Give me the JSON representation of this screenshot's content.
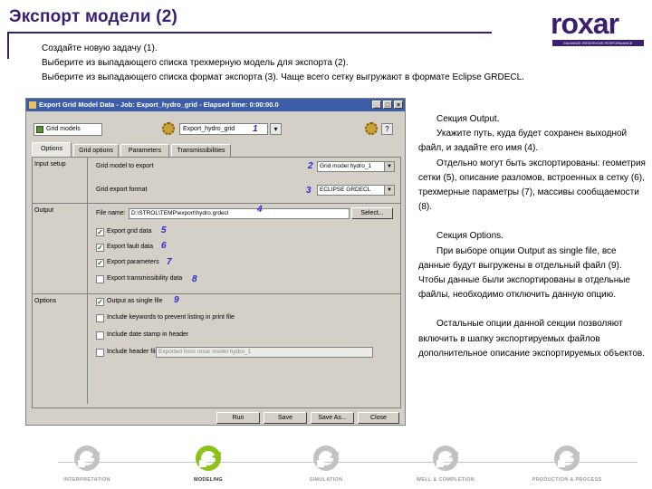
{
  "header": {
    "title": "Экспорт модели (2)",
    "logo_text": "roxar",
    "logo_strap": "MAXIMIZE RESERVOIR PERFORMANCE"
  },
  "intro_lines": [
    "Создайте новую задачу (1).",
    "Выберите из выпадающего списка трехмерную модель для экспорта (2).",
    "Выберите из выпадающего списка формат экспорта (3). Чаще всего сетку выгружают в формате Eclipse GRDECL."
  ],
  "dialog": {
    "title": "Export Grid Model Data - Job: Export_hydro_grid - Elapsed time: 0:00:00.0",
    "window_buttons": [
      "_",
      "□",
      "×"
    ],
    "toolbar": {
      "object_name": "Grid models",
      "job_name": "Export_hydro_grid",
      "button_glyphs": [
        "▾",
        "?"
      ]
    },
    "tabs": [
      "Options",
      "Grid options",
      "Parameters",
      "Transmissibilities"
    ],
    "sections": {
      "input": "Input setup",
      "output": "Output",
      "options": "Options"
    },
    "input": {
      "model_label": "Grid model to export",
      "model_value": "Grid model hydro_1",
      "format_label": "Grid export format",
      "format_value": "ECLIPSE GRDECL"
    },
    "output": {
      "file_label": "File name:",
      "file_value": "D:\\STROL\\TEMP\\export\\hydro.grdecl",
      "select_button": "Select...",
      "checkboxes": [
        {
          "label": "Export grid data",
          "checked": true
        },
        {
          "label": "Export fault data",
          "checked": true
        },
        {
          "label": "Export parameters",
          "checked": true
        },
        {
          "label": "Export transmissibility data",
          "checked": false
        }
      ]
    },
    "options": {
      "checkboxes": [
        {
          "label": "Output as single file",
          "checked": true
        },
        {
          "label": "Include keywords to prevent listing in print file",
          "checked": false
        },
        {
          "label": "Include date stamp in header",
          "checked": false
        },
        {
          "label": "Include header file",
          "checked": false
        }
      ],
      "header_field": "Exported from roxar model hydro_1"
    },
    "bottom_buttons": [
      "Run",
      "Save",
      "Save As...",
      "Close"
    ],
    "callouts": [
      "1",
      "2",
      "3",
      "4",
      "5",
      "6",
      "7",
      "8",
      "9"
    ]
  },
  "right_text": {
    "para1": "Секция Output.",
    "para2": "Укажите путь, куда будет сохранен выходной файл, и задайте его имя (4).",
    "para3": "Отдельно могут быть экспортированы: геометрия сетки (5), описание разломов, встроенных в сетку (6), трехмерные параметры (7), массивы сообщаемости (8).",
    "para4": "Секция Options.",
    "para5": "При выборе опции Output as single file, все данные будут выгружены в отдельный файл (9). Чтобы данные были экспортированы в отдельные файлы, необходимо отключить данную опцию.",
    "para6": "Остальные опции данной секции позволяют включить в шапку экспортируемых файлов дополнительное описание экспортируемых объектов."
  },
  "bottom_nav": [
    {
      "label": "INTERPRETATION",
      "active": false
    },
    {
      "label": "MODELING",
      "active": true
    },
    {
      "label": "SIMULATION",
      "active": false
    },
    {
      "label": "WELL & COMPLETION",
      "active": false
    },
    {
      "label": "PRODUCTION & PROCESS",
      "active": false
    }
  ],
  "colors": {
    "brand": "#3a1f6e",
    "active_nav": "#8cc21a",
    "callout": "#2a2ad8"
  }
}
